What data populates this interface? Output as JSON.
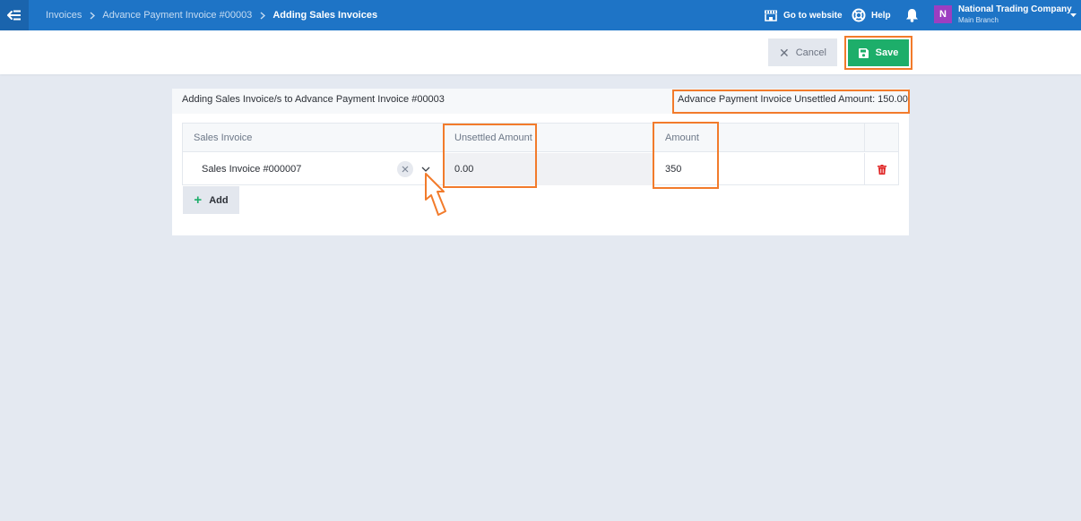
{
  "nav": {
    "breadcrumb": [
      "Invoices",
      "Advance Payment Invoice #00003"
    ],
    "current": "Adding Sales Invoices",
    "go_to_website": "Go to website",
    "help": "Help",
    "company": {
      "initial": "N",
      "name": "National Trading Company",
      "branch": "Main Branch"
    }
  },
  "actions": {
    "cancel": "Cancel",
    "save": "Save"
  },
  "card": {
    "title": "Adding Sales Invoice/s to Advance Payment Invoice #00003",
    "unsettled_total": "Advance Payment Invoice Unsettled Amount: 150.00"
  },
  "table": {
    "headers": {
      "invoice": "Sales Invoice",
      "unsettled": "Unsettled Amount",
      "amount": "Amount"
    },
    "rows": [
      {
        "invoice": "Sales Invoice #000007",
        "unsettled": "0.00",
        "amount": "350"
      }
    ],
    "add_label": "Add"
  },
  "icons": {
    "menu": "menu-toggle-icon",
    "website": "store-icon",
    "help": "lifebuoy-icon",
    "notifications": "bell-icon",
    "save": "floppy-disk-icon",
    "cancel": "close-icon",
    "delete": "trash-icon",
    "add": "plus-icon"
  },
  "colors": {
    "topbar": "#1e74c6",
    "save": "#1dae6a",
    "highlight": "#f27b2b",
    "delete": "#e02424",
    "avatar": "#9c3ec1"
  }
}
